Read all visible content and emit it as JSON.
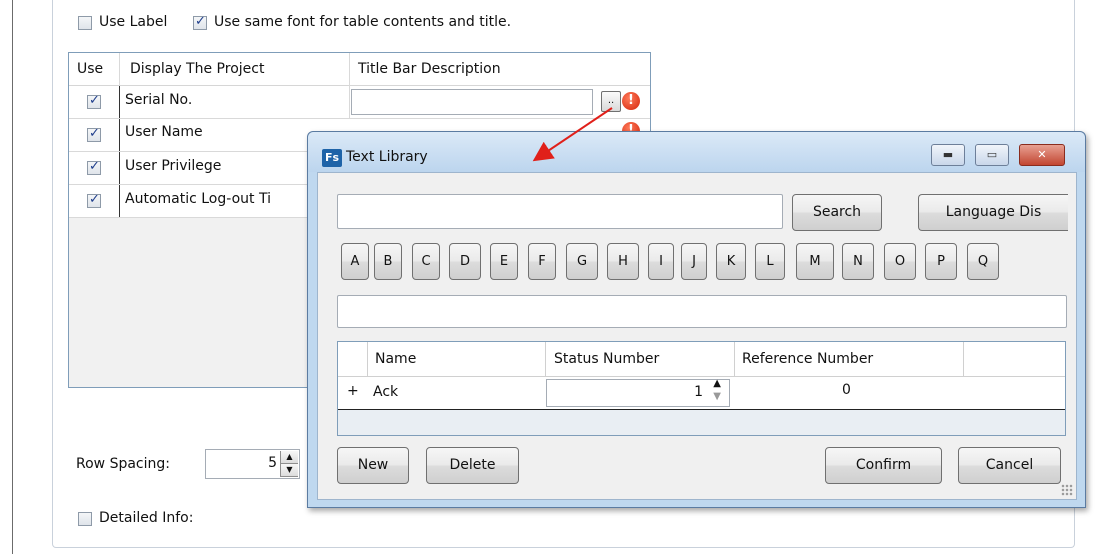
{
  "options": {
    "use_label": "Use Label",
    "same_font": "Use same font for table contents and title.",
    "use_label_checked": false,
    "same_font_checked": true
  },
  "table": {
    "headers": [
      "Use",
      "Display The Project",
      "Title Bar Description"
    ],
    "rows": [
      {
        "checked": true,
        "project": "Serial No."
      },
      {
        "checked": true,
        "project": "User Name"
      },
      {
        "checked": true,
        "project": "User Privilege"
      },
      {
        "checked": true,
        "project": "Automatic Log-out Ti"
      }
    ],
    "ellipsis_button": "..",
    "warning_icon": "!"
  },
  "row_spacing": {
    "label": "Row Spacing:",
    "value": "5"
  },
  "detailed_info": {
    "label": "Detailed Info:",
    "checked": false
  },
  "dialog": {
    "title": "Text Library",
    "app_icon": "Fs",
    "search_value": "",
    "search_button": "Search",
    "language_button": "Language Dis",
    "letters": [
      "A",
      "B",
      "C",
      "D",
      "E",
      "F",
      "G",
      "H",
      "I",
      "J",
      "K",
      "L",
      "M",
      "N",
      "O",
      "P",
      "Q"
    ],
    "text_value": "",
    "headers": [
      "Name",
      "Status Number",
      "Reference Number"
    ],
    "rows": [
      {
        "expander": "+",
        "name": "Ack",
        "status_number": "1",
        "reference_number": "0"
      }
    ],
    "buttons": {
      "new": "New",
      "delete": "Delete",
      "confirm": "Confirm",
      "cancel": "Cancel"
    },
    "window_buttons": {
      "minimize": "▬",
      "maximize": "▭",
      "close": "✕"
    }
  },
  "colors": {
    "annotation_arrow": "#e0201a",
    "accent": "#1e63a8"
  }
}
